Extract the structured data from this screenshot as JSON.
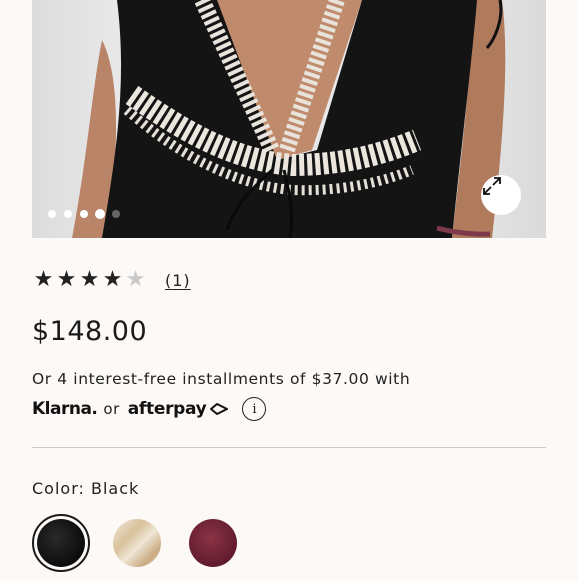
{
  "product": {
    "gallery": {
      "slide_count": 5,
      "active_slide": 4,
      "expand_icon": "expand-arrows-icon"
    },
    "rating": {
      "stars_filled": 4,
      "stars_total": 5,
      "review_count_label": "(1)"
    },
    "price": "$148.00",
    "installments_text": "Or 4 interest-free installments of $37.00 with",
    "payment": {
      "klarna_label": "Klarna.",
      "or_label": "or",
      "afterpay_label": "afterpay",
      "info_icon": "info-icon"
    },
    "color": {
      "label": "Color: Black",
      "swatches": [
        {
          "name": "Black",
          "selected": true,
          "hex": "#111111"
        },
        {
          "name": "Cream",
          "selected": false,
          "hex": "#e6d6bb"
        },
        {
          "name": "Wine",
          "selected": false,
          "hex": "#6e2236"
        }
      ]
    }
  },
  "colors": {
    "background": "#fcf9f7",
    "text": "#1a1a1a",
    "divider": "#cfcac6"
  }
}
